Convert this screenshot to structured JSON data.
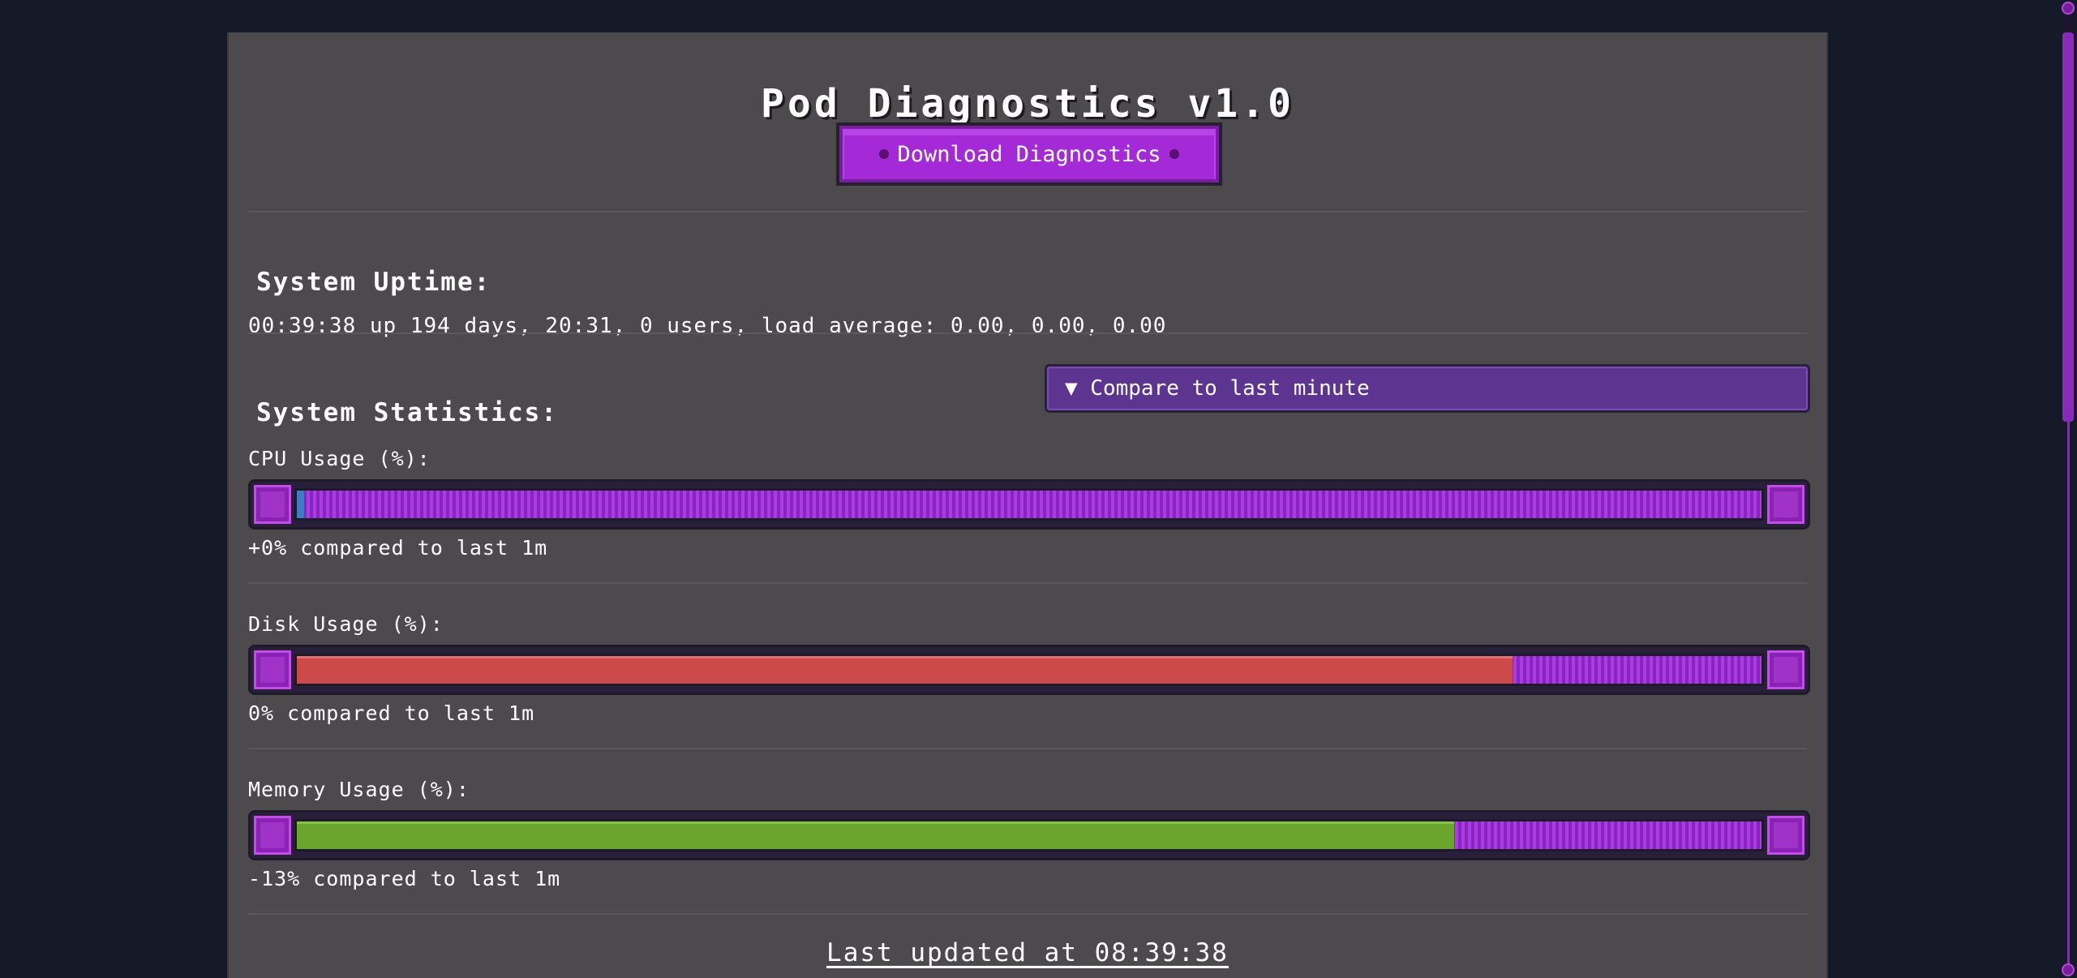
{
  "app": {
    "title": "Pod Diagnostics v1.0",
    "download_label": "Download Diagnostics"
  },
  "uptime": {
    "heading": "System Uptime:",
    "text": "00:39:38 up 194 days, 20:31, 0 users, load average: 0.00, 0.00, 0.00"
  },
  "stats": {
    "heading": "System Statistics:",
    "compare_toggle": "▼ Compare to last minute",
    "metrics": [
      {
        "label": "CPU Usage (%):",
        "value_fraction": 0.005,
        "compare": "+0% compared to last 1m",
        "color": "#3f7cc4"
      },
      {
        "label": "Disk Usage (%):",
        "value_fraction": 0.83,
        "compare": "0% compared to last 1m",
        "color": "#cc4a4a"
      },
      {
        "label": "Memory Usage (%):",
        "value_fraction": 0.79,
        "compare": "-13% compared to last 1m",
        "color": "#6aa52e"
      }
    ]
  },
  "footer": {
    "last_updated": "Last updated at 08:39:38"
  }
}
